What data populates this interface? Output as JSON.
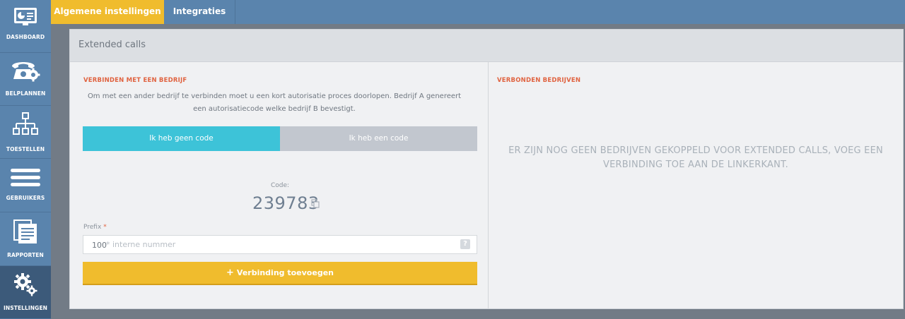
{
  "sidebar": {
    "items": [
      {
        "label": "DASHBOARD",
        "icon": "dashboard-icon"
      },
      {
        "label": "BELPLANNEN",
        "icon": "phone-gear-icon"
      },
      {
        "label": "TOESTELLEN",
        "icon": "network-tree-icon"
      },
      {
        "label": "GEBRUIKERS",
        "icon": "users-list-icon"
      },
      {
        "label": "RAPPORTEN",
        "icon": "reports-icon"
      },
      {
        "label": "INSTELLINGEN",
        "icon": "settings-gears-icon",
        "active": true
      }
    ]
  },
  "tabs": [
    {
      "label": "Algemene instellingen",
      "active": true
    },
    {
      "label": "Integraties",
      "active": false
    }
  ],
  "panel": {
    "title": "Extended calls",
    "left": {
      "section_title": "VERBINDEN MET EEN BEDRIJF",
      "description": "Om met een ander bedrijf te verbinden moet u een kort autorisatie proces doorlopen. Bedrijf A genereert een autorisatiecode welke bedrijf B bevestigt.",
      "toggle": {
        "no_code": "Ik heb geen code",
        "have_code": "Ik heb een code"
      },
      "code_label": "Code:",
      "code_value": "239783",
      "prefix_label": "Prefix",
      "prefix_required_mark": "*",
      "prefix_number": "100",
      "prefix_placeholder": "* interne nummer",
      "help_mark": "?",
      "add_button_icon": "+",
      "add_button": "Verbinding toevoegen"
    },
    "right": {
      "section_title": "VERBONDEN BEDRIJVEN",
      "empty_message": "ER ZIJN NOG GEEN BEDRIJVEN GEKOPPELD VOOR EXTENDED CALLS, VOEG EEN VERBINDING TOE AAN DE LINKERKANT."
    }
  },
  "colors": {
    "sidebar": "#5a84ad",
    "sidebar_active": "#3c5a7a",
    "accent_yellow": "#f0bc2d",
    "accent_cyan": "#3dc3d8",
    "section_title": "#e0623f"
  }
}
